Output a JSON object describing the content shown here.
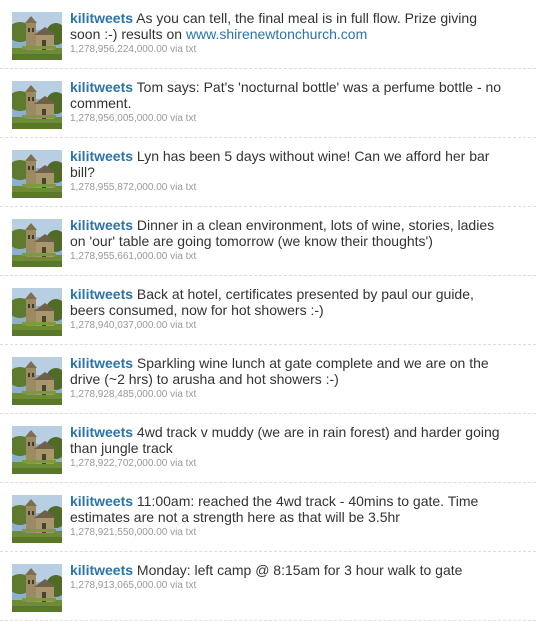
{
  "colors": {
    "link": "#2b73a8",
    "text": "#333333",
    "meta": "#999999",
    "divider": "#dddddd"
  },
  "avatar_icon": "church-photo-icon",
  "tweets": [
    {
      "user": "kilitweets",
      "text_before": " As you can tell, the final meal is in full flow. Prize giving soon :-) results on ",
      "link": "www.shirenewtonchurch.com",
      "timestamp": "1,278,956,224,000.00",
      "source": "via txt"
    },
    {
      "user": "kilitweets",
      "text_before": " Tom says: Pat's 'nocturnal bottle' was a perfume bottle - no comment.",
      "timestamp": "1,278,956,005,000.00",
      "source": "via txt"
    },
    {
      "user": "kilitweets",
      "text_before": " Lyn has been 5 days without wine! Can we afford her bar bill?",
      "timestamp": "1,278,955,872,000.00",
      "source": "via txt"
    },
    {
      "user": "kilitweets",
      "text_before": " Dinner in a clean environment, lots of wine, stories, ladies on 'our' table are going tomorrow (we know their thoughts')",
      "timestamp": "1,278,955,661,000.00",
      "source": "via txt"
    },
    {
      "user": "kilitweets",
      "text_before": " Back at hotel, certificates presented by paul our guide, beers consumed, now for hot showers :-)",
      "timestamp": "1,278,940,037,000.00",
      "source": "via txt"
    },
    {
      "user": "kilitweets",
      "text_before": " Sparkling wine lunch at gate complete and we are on the drive (~2 hrs) to arusha and hot showers :-)",
      "timestamp": "1,278,928,485,000.00",
      "source": "via txt"
    },
    {
      "user": "kilitweets",
      "text_before": " 4wd track v muddy (we are in rain forest) and harder going than jungle track",
      "timestamp": "1,278,922,702,000.00",
      "source": "via txt"
    },
    {
      "user": "kilitweets",
      "text_before": " 11:00am: reached the 4wd track - 40mins to gate. Time estimates are not a strength here as that will be 3.5hr",
      "timestamp": "1,278,921,550,000.00",
      "source": "via txt"
    },
    {
      "user": "kilitweets",
      "text_before": " Monday: left camp @ 8:15am for 3 hour walk to gate",
      "timestamp": "1,278,913,065,000.00",
      "source": "via txt"
    }
  ]
}
